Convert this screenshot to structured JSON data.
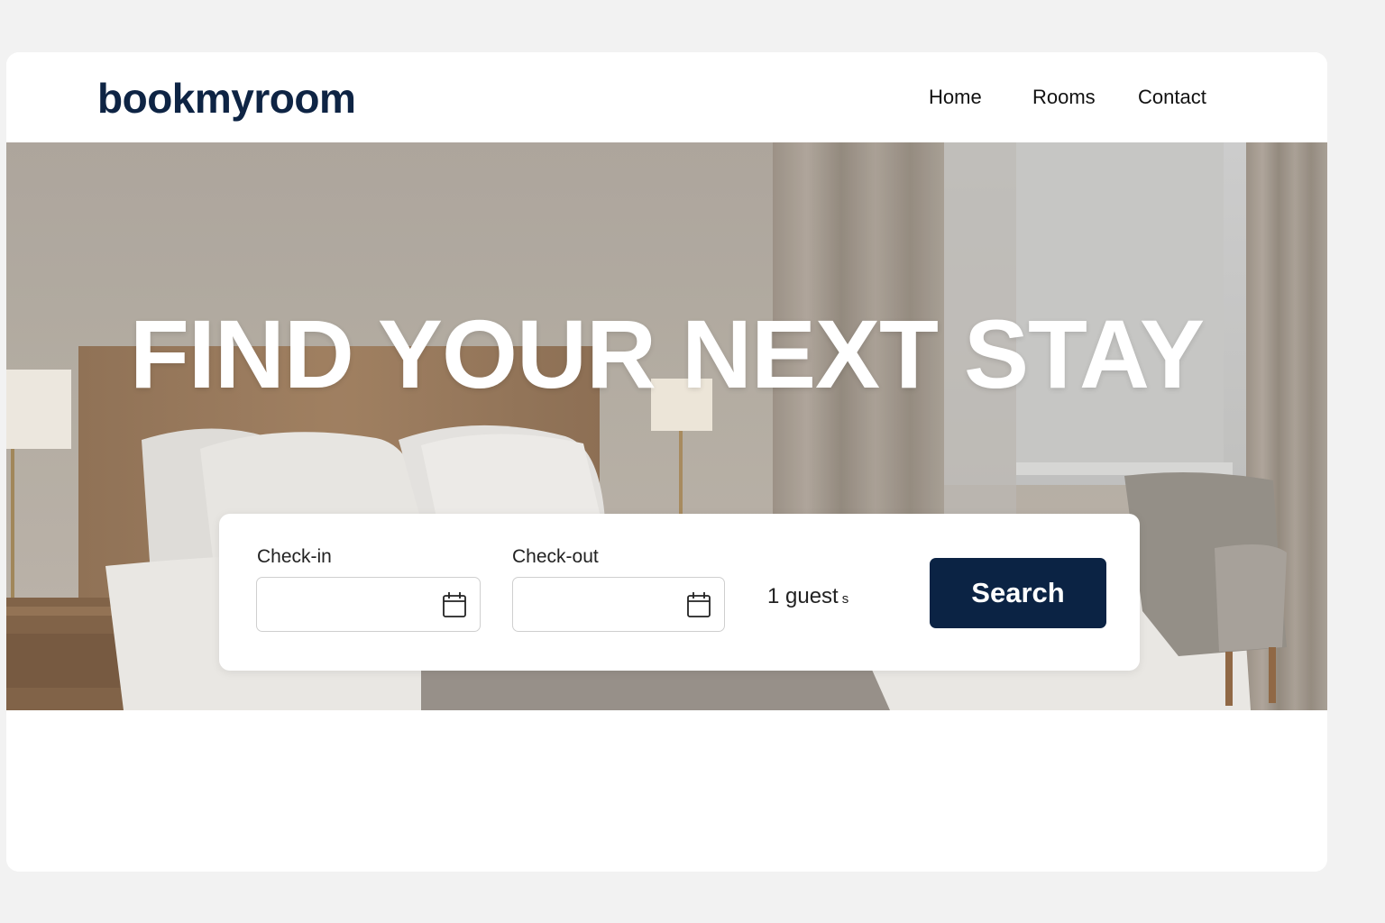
{
  "brand": {
    "logo": "bookmyroom",
    "accent_color": "#0b2344"
  },
  "nav": {
    "items": [
      {
        "label": "Home"
      },
      {
        "label": "Rooms"
      },
      {
        "label": "Contact"
      }
    ]
  },
  "hero": {
    "title": "FIND YOUR NEXT STAY",
    "background": "hotel-bedroom-photo"
  },
  "search": {
    "checkin": {
      "label": "Check-in",
      "value": "",
      "icon": "calendar-icon"
    },
    "checkout": {
      "label": "Check-out",
      "value": "",
      "icon": "calendar-icon"
    },
    "guests": {
      "value": "1 guest",
      "suffix": "s"
    },
    "button_label": "Search"
  }
}
